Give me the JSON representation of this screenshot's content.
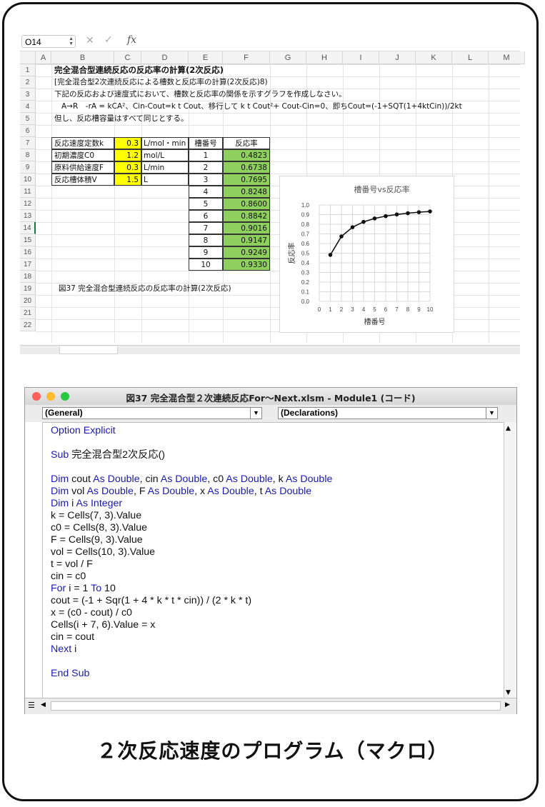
{
  "excel": {
    "name_box": "O14",
    "column_headers": [
      "A",
      "B",
      "C",
      "D",
      "E",
      "F",
      "G",
      "H",
      "I",
      "J",
      "K",
      "L",
      "M"
    ],
    "row_numbers": [
      "1",
      "2",
      "3",
      "4",
      "5",
      "6",
      "7",
      "8",
      "9",
      "10",
      "11",
      "12",
      "13",
      "14",
      "15",
      "16",
      "17",
      "18",
      "19",
      "20",
      "21",
      "22"
    ],
    "selected_row": "14",
    "title": "完全混合型連続反応の反応率の計算(2次反応)",
    "row2": "[完全混合型2次連続反応による槽数と反応率の計算(2次反応)8)",
    "row3": "下記の反応および速度式において、槽数と反応率の関係を示すグラフを作成しなさい。",
    "row4": "A→R　-rA = kCA²、Cin-Cout=k t Cout、移行して k t Cout²+ Cout-Cin=0、即ちCout=(-1+SQT(1+4ktCin))/2kt",
    "row5": "但し、反応槽容量はすべて同じとする。",
    "params": [
      {
        "label": "反応速度定数k",
        "value": "0.3",
        "unit": "L/mol・min"
      },
      {
        "label": "初期濃度C0",
        "value": "1.2",
        "unit": "mol/L"
      },
      {
        "label": "原料供給速度F",
        "value": "0.3",
        "unit": "L/min"
      },
      {
        "label": "反応槽体積V",
        "value": "1.5",
        "unit": "L"
      }
    ],
    "table_headers": {
      "tank": "槽番号",
      "rate": "反応率"
    },
    "table_rows": [
      {
        "tank": "1",
        "rate": "0.4823"
      },
      {
        "tank": "2",
        "rate": "0.6738"
      },
      {
        "tank": "3",
        "rate": "0.7695"
      },
      {
        "tank": "4",
        "rate": "0.8248"
      },
      {
        "tank": "5",
        "rate": "0.8600"
      },
      {
        "tank": "6",
        "rate": "0.8842"
      },
      {
        "tank": "7",
        "rate": "0.9016"
      },
      {
        "tank": "8",
        "rate": "0.9147"
      },
      {
        "tank": "9",
        "rate": "0.9249"
      },
      {
        "tank": "10",
        "rate": "0.9330"
      }
    ],
    "figure_caption": "図37  完全混合型連続反応の反応率の計算(2次反応)"
  },
  "chart_data": {
    "type": "line",
    "title": "槽番号vs反応率",
    "xlabel": "槽番号",
    "ylabel": "反応率",
    "x": [
      1,
      2,
      3,
      4,
      5,
      6,
      7,
      8,
      9,
      10
    ],
    "y": [
      0.4823,
      0.6738,
      0.7695,
      0.8248,
      0.86,
      0.8842,
      0.9016,
      0.9147,
      0.9249,
      0.933
    ],
    "xlim": [
      0,
      10
    ],
    "ylim": [
      0,
      1.0
    ],
    "xticks": [
      "0",
      "1",
      "2",
      "3",
      "4",
      "5",
      "6",
      "7",
      "8",
      "9",
      "10"
    ],
    "yticks": [
      "0.0",
      "0.1",
      "0.2",
      "0.3",
      "0.4",
      "0.5",
      "0.6",
      "0.7",
      "0.8",
      "0.9",
      "1.0"
    ],
    "grid": true,
    "legend": "none"
  },
  "vba": {
    "title": "図37 完全混合型２次連続反応For～Next.xlsm - Module1 (コード)",
    "object_combo": "(General)",
    "proc_combo": "(Declarations)",
    "code": [
      [
        {
          "t": "Option Explicit",
          "k": true
        }
      ],
      [],
      [
        {
          "t": "Sub",
          "k": true
        },
        {
          "t": " 完全混合型2次反応()",
          "k": false
        }
      ],
      [],
      [
        {
          "t": "Dim",
          "k": true
        },
        {
          "t": " cout ",
          "k": false
        },
        {
          "t": "As Double",
          "k": true
        },
        {
          "t": ", cin ",
          "k": false
        },
        {
          "t": "As Double",
          "k": true
        },
        {
          "t": ", c0 ",
          "k": false
        },
        {
          "t": "As Double",
          "k": true
        },
        {
          "t": ", k ",
          "k": false
        },
        {
          "t": "As Double",
          "k": true
        }
      ],
      [
        {
          "t": "Dim",
          "k": true
        },
        {
          "t": " vol ",
          "k": false
        },
        {
          "t": "As Double",
          "k": true
        },
        {
          "t": ", F ",
          "k": false
        },
        {
          "t": "As Double",
          "k": true
        },
        {
          "t": ", x ",
          "k": false
        },
        {
          "t": "As Double",
          "k": true
        },
        {
          "t": ", t ",
          "k": false
        },
        {
          "t": "As Double",
          "k": true
        }
      ],
      [
        {
          "t": "Dim",
          "k": true
        },
        {
          "t": " i ",
          "k": false
        },
        {
          "t": "As Integer",
          "k": true
        }
      ],
      [
        {
          "t": "k = Cells(7, 3).Value",
          "k": false
        }
      ],
      [
        {
          "t": "c0 = Cells(8, 3).Value",
          "k": false
        }
      ],
      [
        {
          "t": "F = Cells(9, 3).Value",
          "k": false
        }
      ],
      [
        {
          "t": "vol = Cells(10, 3).Value",
          "k": false
        }
      ],
      [
        {
          "t": "t = vol / F",
          "k": false
        }
      ],
      [
        {
          "t": "cin = c0",
          "k": false
        }
      ],
      [
        {
          "t": "For",
          "k": true
        },
        {
          "t": " i = 1 ",
          "k": false
        },
        {
          "t": "To",
          "k": true
        },
        {
          "t": " 10",
          "k": false
        }
      ],
      [
        {
          "t": "cout = (-1 + Sqr(1 + 4 * k * t * cin)) / (2 * k * t)",
          "k": false
        }
      ],
      [
        {
          "t": "x = (c0 - cout) / c0",
          "k": false
        }
      ],
      [
        {
          "t": "Cells(i + 7, 6).Value = x",
          "k": false
        }
      ],
      [
        {
          "t": "cin = cout",
          "k": false
        }
      ],
      [
        {
          "t": "Next",
          "k": true
        },
        {
          "t": " i",
          "k": false
        }
      ],
      [],
      [
        {
          "t": "End Sub",
          "k": true
        }
      ]
    ]
  },
  "caption": "２次反応速度のプログラム（マクロ）",
  "colors": {
    "yellow": "#ffff00",
    "green": "#8fcf5e",
    "keyword": "#1a1ab0",
    "close": "#ff5f57",
    "minimize": "#febc2e",
    "zoom": "#28c840"
  }
}
